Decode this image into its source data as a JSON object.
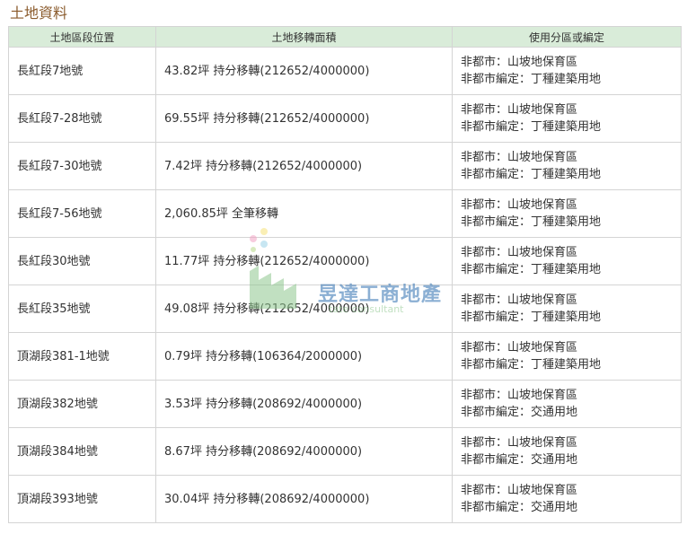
{
  "section_title": "土地資料",
  "headers": [
    "土地區段位置",
    "土地移轉面積",
    "使用分區或編定"
  ],
  "rows": [
    {
      "location": "長紅段7地號",
      "area": "43.82坪 持分移轉(212652/4000000)",
      "zoning1": "非都市：山坡地保育區",
      "zoning2": "非都市編定：丁種建築用地"
    },
    {
      "location": "長紅段7-28地號",
      "area": "69.55坪 持分移轉(212652/4000000)",
      "zoning1": "非都市：山坡地保育區",
      "zoning2": "非都市編定：丁種建築用地"
    },
    {
      "location": "長紅段7-30地號",
      "area": "7.42坪 持分移轉(212652/4000000)",
      "zoning1": "非都市：山坡地保育區",
      "zoning2": "非都市編定：丁種建築用地"
    },
    {
      "location": "長紅段7-56地號",
      "area": "2,060.85坪 全筆移轉",
      "zoning1": "非都市：山坡地保育區",
      "zoning2": "非都市編定：丁種建築用地"
    },
    {
      "location": "長紅段30地號",
      "area": "11.77坪 持分移轉(212652/4000000)",
      "zoning1": "非都市：山坡地保育區",
      "zoning2": "非都市編定：丁種建築用地"
    },
    {
      "location": "長紅段35地號",
      "area": "49.08坪 持分移轉(212652/4000000)",
      "zoning1": "非都市：山坡地保育區",
      "zoning2": "非都市編定：丁種建築用地"
    },
    {
      "location": "頂湖段381-1地號",
      "area": "0.79坪 持分移轉(106364/2000000)",
      "zoning1": "非都市：山坡地保育區",
      "zoning2": "非都市編定：丁種建築用地"
    },
    {
      "location": "頂湖段382地號",
      "area": "3.53坪 持分移轉(208692/4000000)",
      "zoning1": "非都市：山坡地保育區",
      "zoning2": "非都市編定：交通用地"
    },
    {
      "location": "頂湖段384地號",
      "area": "8.67坪 持分移轉(208692/4000000)",
      "zoning1": "非都市：山坡地保育區",
      "zoning2": "非都市編定：交通用地"
    },
    {
      "location": "頂湖段393地號",
      "area": "30.04坪 持分移轉(208692/4000000)",
      "zoning1": "非都市：山坡地保育區",
      "zoning2": "非都市編定：交通用地"
    }
  ],
  "watermark": {
    "name": "昱達工商地產",
    "subtitle": "tate consultant"
  },
  "colors": {
    "title": "#8a5a2b",
    "header_bg": "#d9ecd9",
    "border": "#d4d4d4",
    "text": "#333333",
    "watermark_blue": "#2e6fb0",
    "watermark_green": "#8fc78f"
  }
}
